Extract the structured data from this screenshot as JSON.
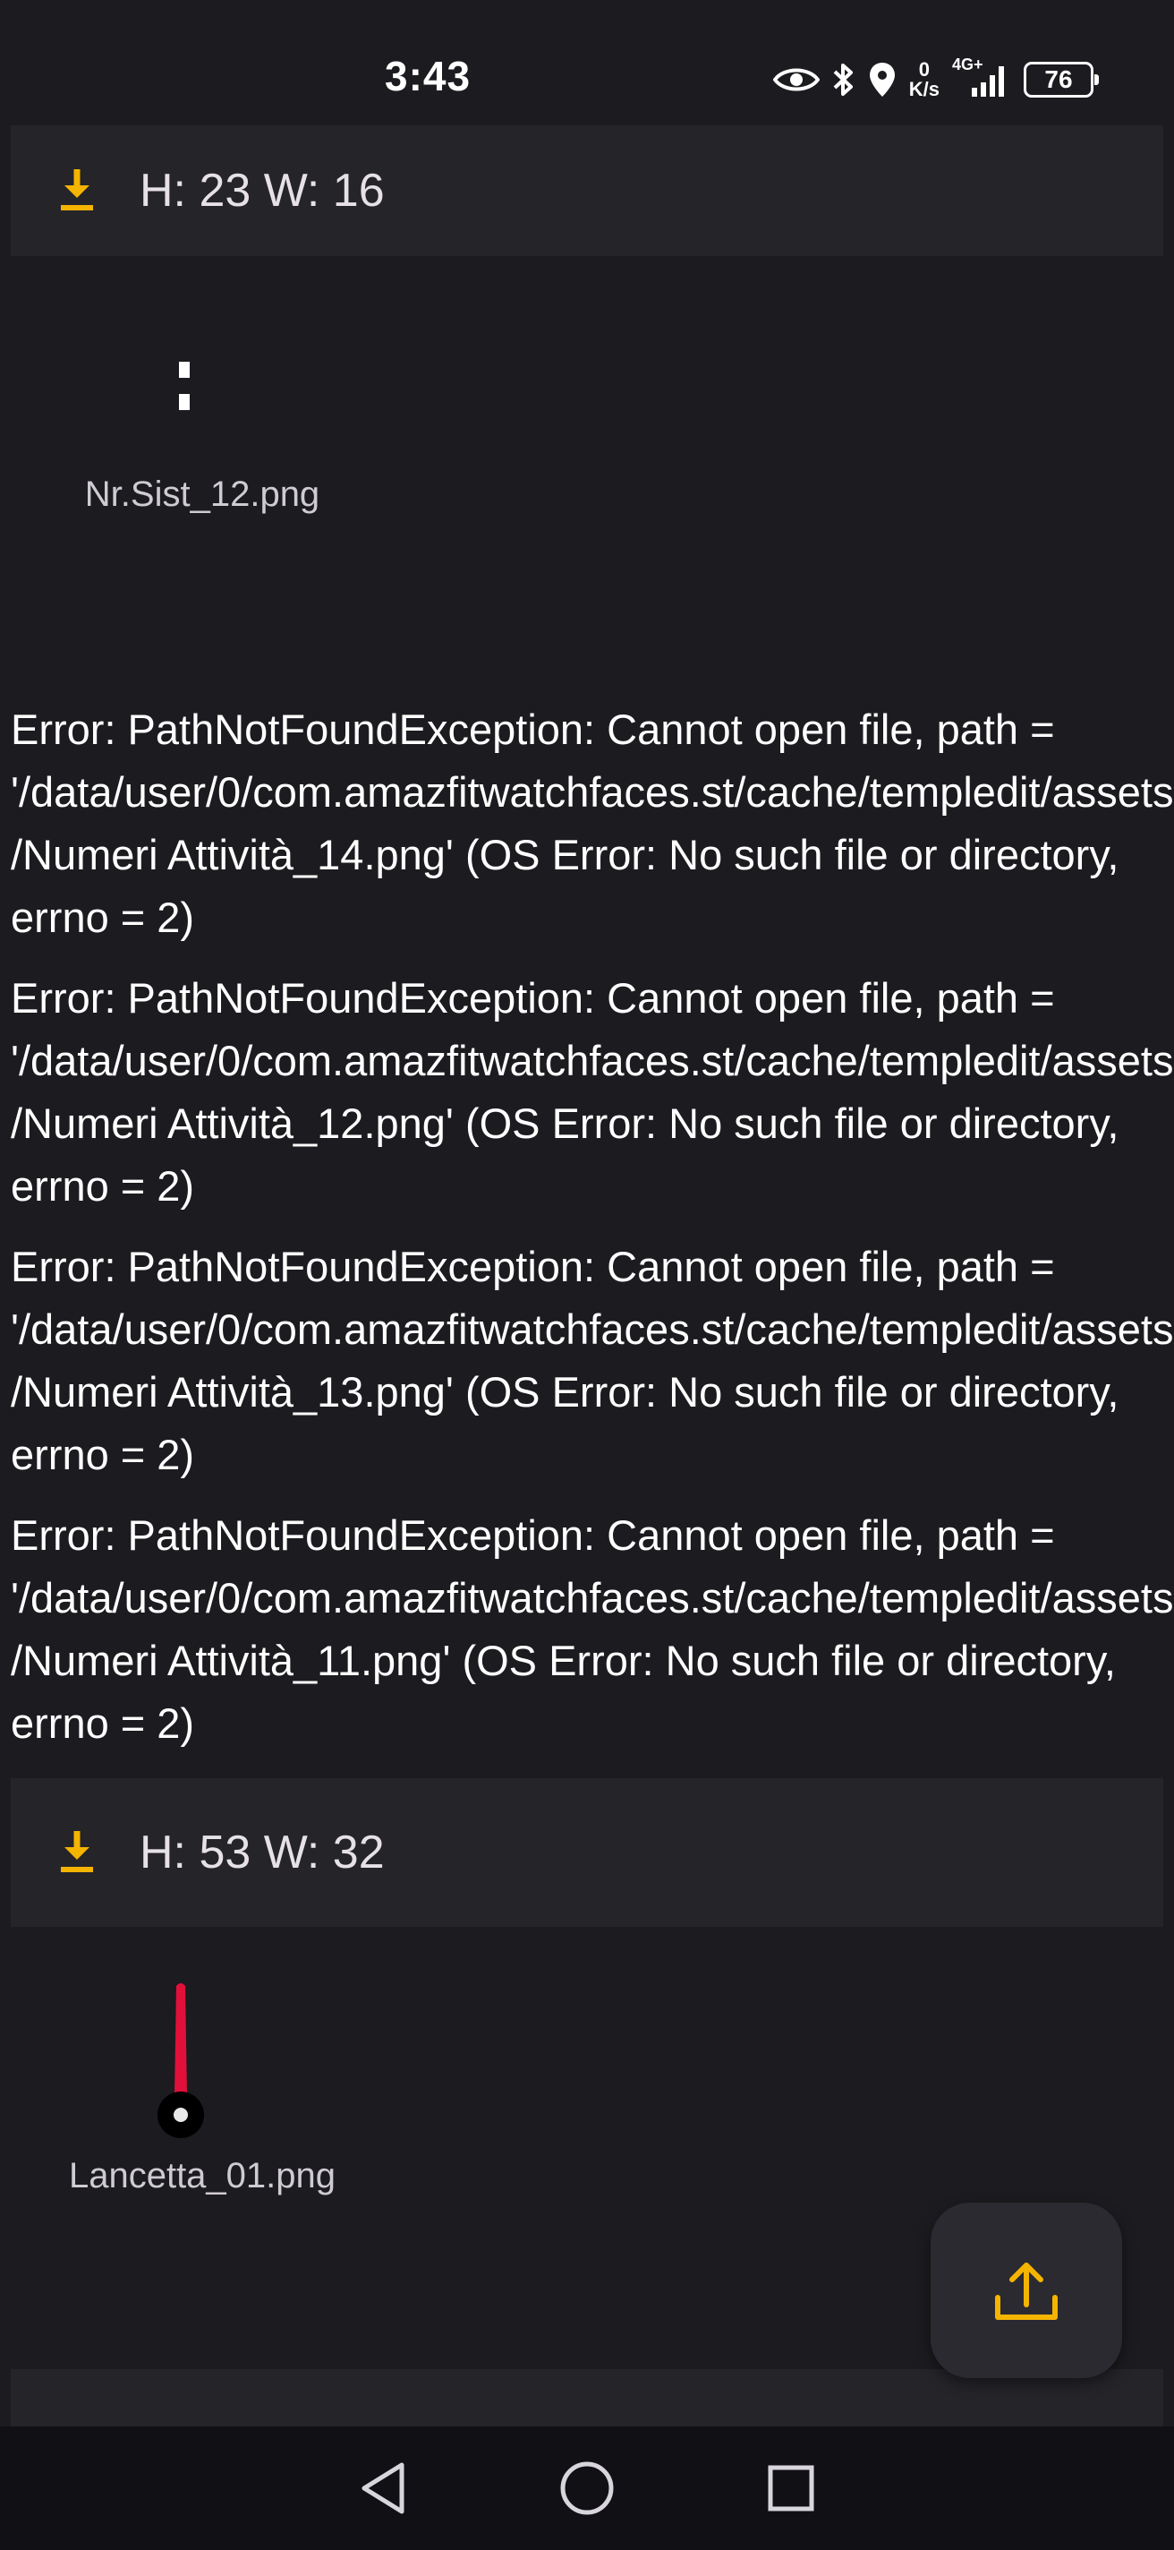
{
  "status_bar": {
    "time": "3:43",
    "net_speed_value": "0",
    "net_speed_unit": "K/s",
    "network": "4G+",
    "battery_level": "76"
  },
  "assets": [
    {
      "header": "H: 23 W: 16",
      "file_name": "Nr.Sist_12.png"
    },
    {
      "header": "H: 53 W: 32",
      "file_name": "Lancetta_01.png"
    }
  ],
  "errors": [
    "Error: PathNotFoundException: Cannot open file, path = '/data/user/0/com.amazfitwatchfaces.st/cache/templedit/assets/Numeri Attività_14.png' (OS Error: No such file or directory, errno = 2)",
    "Error: PathNotFoundException: Cannot open file, path = '/data/user/0/com.amazfitwatchfaces.st/cache/templedit/assets/Numeri Attività_12.png' (OS Error: No such file or directory, errno = 2)",
    "Error: PathNotFoundException: Cannot open file, path = '/data/user/0/com.amazfitwatchfaces.st/cache/templedit/assets/Numeri Attività_13.png' (OS Error: No such file or directory, errno = 2)",
    "Error: PathNotFoundException: Cannot open file, path = '/data/user/0/com.amazfitwatchfaces.st/cache/templedit/assets/Numeri Attività_11.png' (OS Error: No such file or directory, errno = 2)"
  ],
  "colors": {
    "accent": "#f5b400",
    "background": "#1c1b1f",
    "card": "#252429",
    "hand_red": "#e0103a"
  },
  "icons": {
    "download": "download-icon",
    "upload": "upload-icon",
    "back": "back-triangle-icon",
    "home": "home-circle-icon",
    "recents": "recents-square-icon"
  }
}
